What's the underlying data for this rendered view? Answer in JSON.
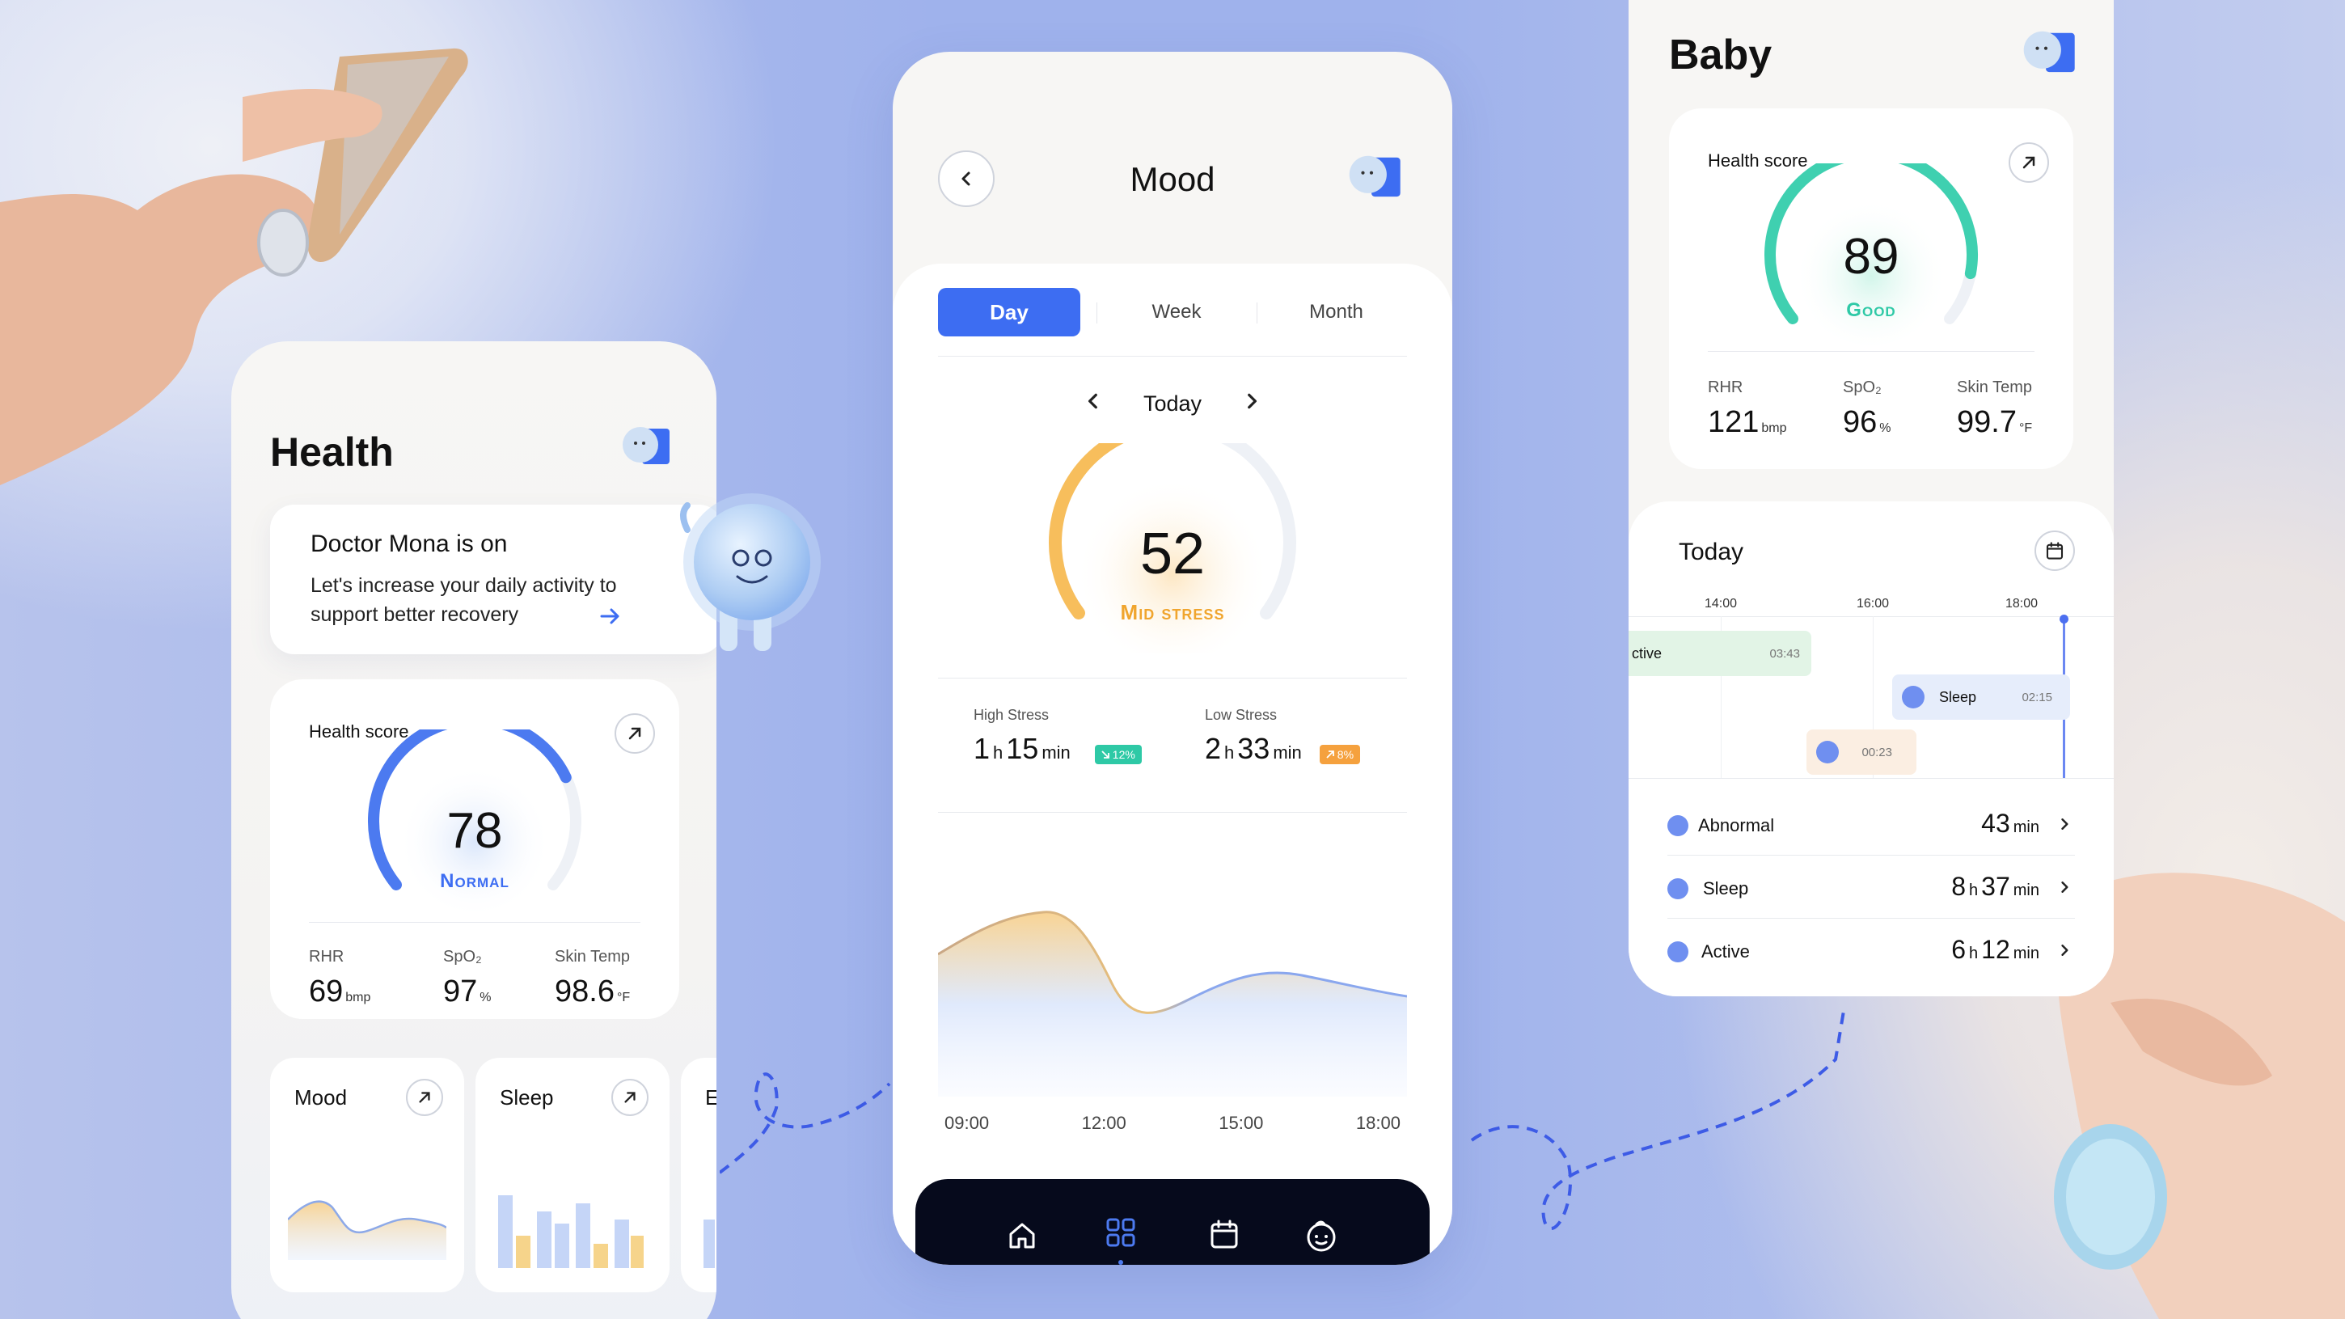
{
  "health": {
    "title": "Health",
    "doctor": {
      "title": "Doctor Mona is on",
      "message_line1": "Let's increase your daily activity to",
      "message_line2": "support better recovery"
    },
    "score_card": {
      "label": "Health score",
      "score": "78",
      "status": "Normal",
      "progress": 0.75,
      "metrics": [
        {
          "label": "RHR",
          "value": "69",
          "unit": "bmp"
        },
        {
          "label": "SpO₂",
          "value": "97",
          "unit": "%"
        },
        {
          "label": "Skin Temp",
          "value": "98.6",
          "unit": "°F"
        }
      ]
    },
    "mini_cards": [
      {
        "label": "Mood"
      },
      {
        "label": "Sleep"
      },
      {
        "label": "E"
      }
    ]
  },
  "mood": {
    "title": "Mood",
    "tabs": [
      "Day",
      "Week",
      "Month"
    ],
    "active_tab": "Day",
    "date_label": "Today",
    "score": "52",
    "status": "Mid stress",
    "progress": 0.52,
    "high_stress": {
      "label": "High Stress",
      "hours": "1",
      "minutes": "15",
      "badge": "12%"
    },
    "low_stress": {
      "label": "Low Stress",
      "hours": "2",
      "minutes": "33",
      "badge": "8%"
    },
    "time_labels": [
      "09:00",
      "12:00",
      "15:00",
      "18:00"
    ],
    "nav": [
      "home-icon",
      "grid-icon",
      "calendar-icon",
      "baby-face-icon"
    ],
    "colors": {
      "accent": "#3d6df2",
      "orange": "#f5b24a",
      "green": "#2ec9a6"
    }
  },
  "baby": {
    "title": "Baby",
    "score_card": {
      "label": "Health score",
      "score": "89",
      "status": "Good",
      "progress": 0.89,
      "metrics": [
        {
          "label": "RHR",
          "value": "121",
          "unit": "bmp"
        },
        {
          "label": "SpO₂",
          "value": "96",
          "unit": "%"
        },
        {
          "label": "Skin Temp",
          "value": "99.7",
          "unit": "°F"
        }
      ]
    },
    "today": {
      "title": "Today",
      "times": [
        "14:00",
        "16:00",
        "18:00"
      ],
      "blocks": [
        {
          "label": "ctive",
          "duration": "03:43"
        },
        {
          "label": "Sleep",
          "duration": "02:15"
        },
        {
          "label": "",
          "duration": "00:23"
        }
      ]
    },
    "list": [
      {
        "label": "Abnormal",
        "hours": "",
        "minutes": "43"
      },
      {
        "label": "Sleep",
        "hours": "8",
        "minutes": "37"
      },
      {
        "label": "Active",
        "hours": "6",
        "minutes": "12"
      }
    ],
    "units": {
      "h": "h",
      "min": "min"
    }
  }
}
